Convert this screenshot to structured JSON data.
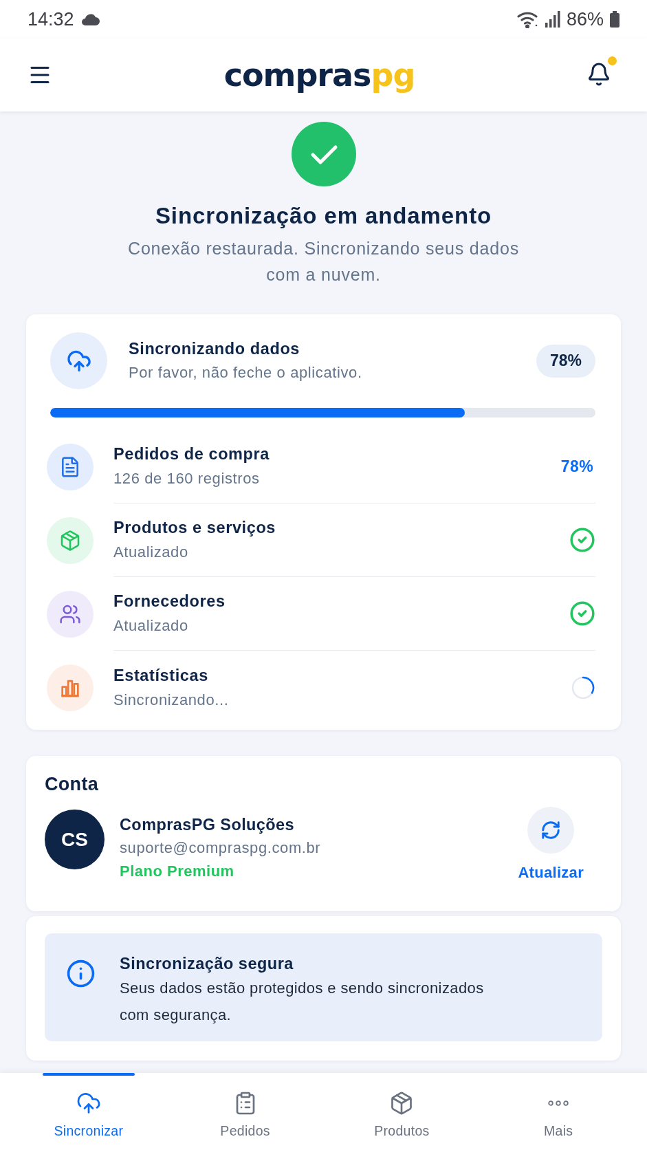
{
  "status_bar": {
    "time": "14:32",
    "battery": "86%"
  },
  "header": {
    "logo": {
      "primary": "compras",
      "accent": "pg"
    },
    "notification_dot": true
  },
  "hero": {
    "title": "Sincronização em andamento",
    "subtitle": "Conexão restaurada. Sincronizando seus dados com a nuvem."
  },
  "sync_card": {
    "title": "Sincronizando dados",
    "subtitle": "Por favor, não feche o aplicativo.",
    "percent": "78%",
    "level": 0.76,
    "items": [
      {
        "kind": "progress",
        "title": "Pedidos de compra",
        "detail": "126 de 160 registros",
        "percent": "78%",
        "color": "#1f6feb"
      },
      {
        "kind": "done",
        "title": "Produtos e serviços",
        "detail": "Atualizado",
        "color": "#22c55e"
      },
      {
        "kind": "done",
        "title": "Fornecedores",
        "detail": "Atualizado",
        "color": "#7c5cd6"
      },
      {
        "kind": "syncing",
        "title": "Estatísticas",
        "detail": "Sincronizando...",
        "color": "#ee7a3a"
      }
    ]
  },
  "account": {
    "heading": "Conta",
    "initials": "CS",
    "name": "ComprasPG Soluções",
    "email": "suporte@compraspg.com.br",
    "plan": "Plano Premium",
    "refresh_label": "Atualizar"
  },
  "notice": {
    "title": "Sincronização segura",
    "text": "Seus dados estão protegidos e sendo sincronizados com segurança."
  },
  "bottom_nav": [
    {
      "label": "Sincronizar",
      "selected": true
    },
    {
      "label": "Pedidos",
      "selected": false
    },
    {
      "label": "Produtos",
      "selected": false
    },
    {
      "label": "Mais",
      "selected": false
    }
  ]
}
